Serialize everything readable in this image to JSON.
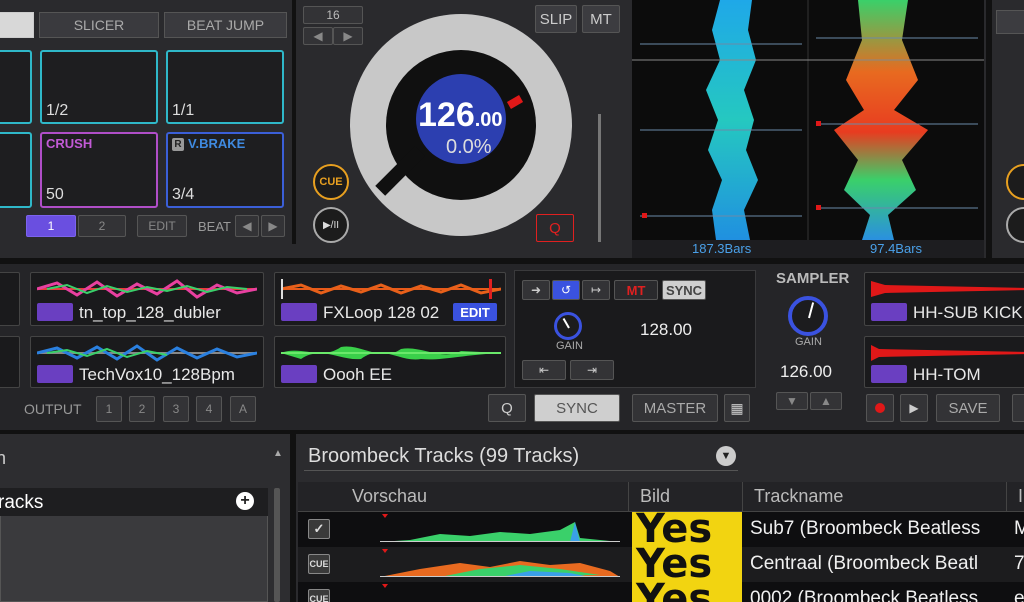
{
  "top": {
    "mode_slicer": "SLICER",
    "mode_beatjump": "BEAT JUMP",
    "pads": [
      {
        "value": "1/2",
        "name": ""
      },
      {
        "value": "1/1",
        "name": ""
      },
      {
        "value": "50",
        "name": "CRUSH"
      },
      {
        "value": "3/4",
        "name": "V.BRAKE",
        "badge": "R"
      }
    ],
    "page_1": "1",
    "page_2": "2",
    "edit": "EDIT",
    "beat": "BEAT",
    "loop_size": "16",
    "slip": "SLIP",
    "mt": "MT",
    "cue": "CUE",
    "play_pause": "▶/II",
    "bpm_int": "126",
    "bpm_dec": ".00",
    "pitch": "0.0%",
    "q": "Q",
    "bars_left": "187.3Bars",
    "bars_right": "97.4Bars"
  },
  "mid": {
    "slots_left": [
      "tn_top_128_dubler",
      "TechVox10_128Bpm"
    ],
    "slots_mid": [
      "FXLoop 128 02",
      "Oooh EE"
    ],
    "slot_edit": "EDIT",
    "output_label": "OUTPUT",
    "output_buttons": [
      "1",
      "2",
      "3",
      "4",
      "A"
    ],
    "mt": "MT",
    "sync": "SYNC",
    "gain": "GAIN",
    "loop_bpm": "128.00",
    "sampler_title": "SAMPLER",
    "sampler_gain": "GAIN",
    "sampler_bpm": "126.00",
    "q": "Q",
    "sync_btn": "SYNC",
    "master_btn": "MASTER",
    "slots_right": [
      "HH-SUB KICK",
      "HH-TOM"
    ],
    "save": "SAVE"
  },
  "browser": {
    "left_item": "racks",
    "left_head": "n",
    "title": "Broombeck Tracks (99 Tracks)",
    "col_preview": "Vorschau",
    "col_image": "Bild",
    "col_track": "Trackname",
    "col_extra": "I",
    "art_text": "Yes",
    "rows": [
      {
        "state": "check",
        "track": "Sub7 (Broombeck Beatless",
        "extra": "M"
      },
      {
        "state": "CUE",
        "track": "Centraal (Broombeck Beatl",
        "extra": "7"
      },
      {
        "state": "CUE",
        "track": "0002 (Broombeck Beatless",
        "extra": "e"
      }
    ]
  },
  "colors": {
    "accent_purple": "#6a3fc1",
    "pad_cyan": "#2fb8c9",
    "cue_orange": "#e8a020",
    "red": "#d42020",
    "bpm_blue": "#3a5bd8"
  }
}
